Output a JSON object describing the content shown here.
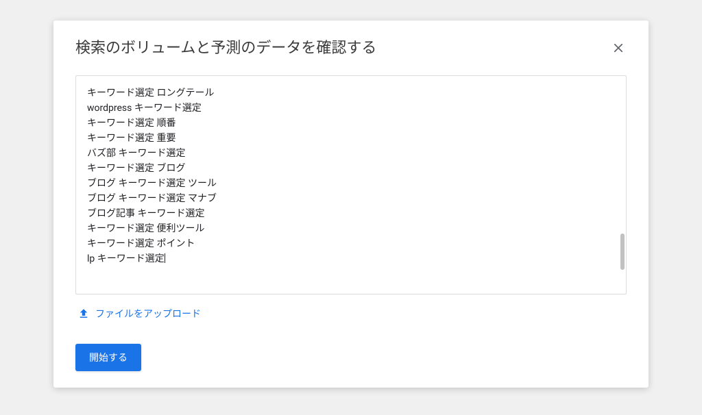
{
  "modal": {
    "title": "検索のボリュームと予測のデータを確認する",
    "keywords_text": "キーワード選定 ロングテール\nwordpress キーワード選定\nキーワード選定 順番\nキーワード選定 重要\nバズ部 キーワード選定\nキーワード選定 ブログ\nブログ キーワード選定 ツール\nブログ キーワード選定 マナブ\nブログ記事 キーワード選定\nキーワード選定 便利ツール\nキーワード選定 ポイント\nlp キーワード選定",
    "upload_label": "ファイルをアップロード",
    "start_button_label": "開始する"
  }
}
